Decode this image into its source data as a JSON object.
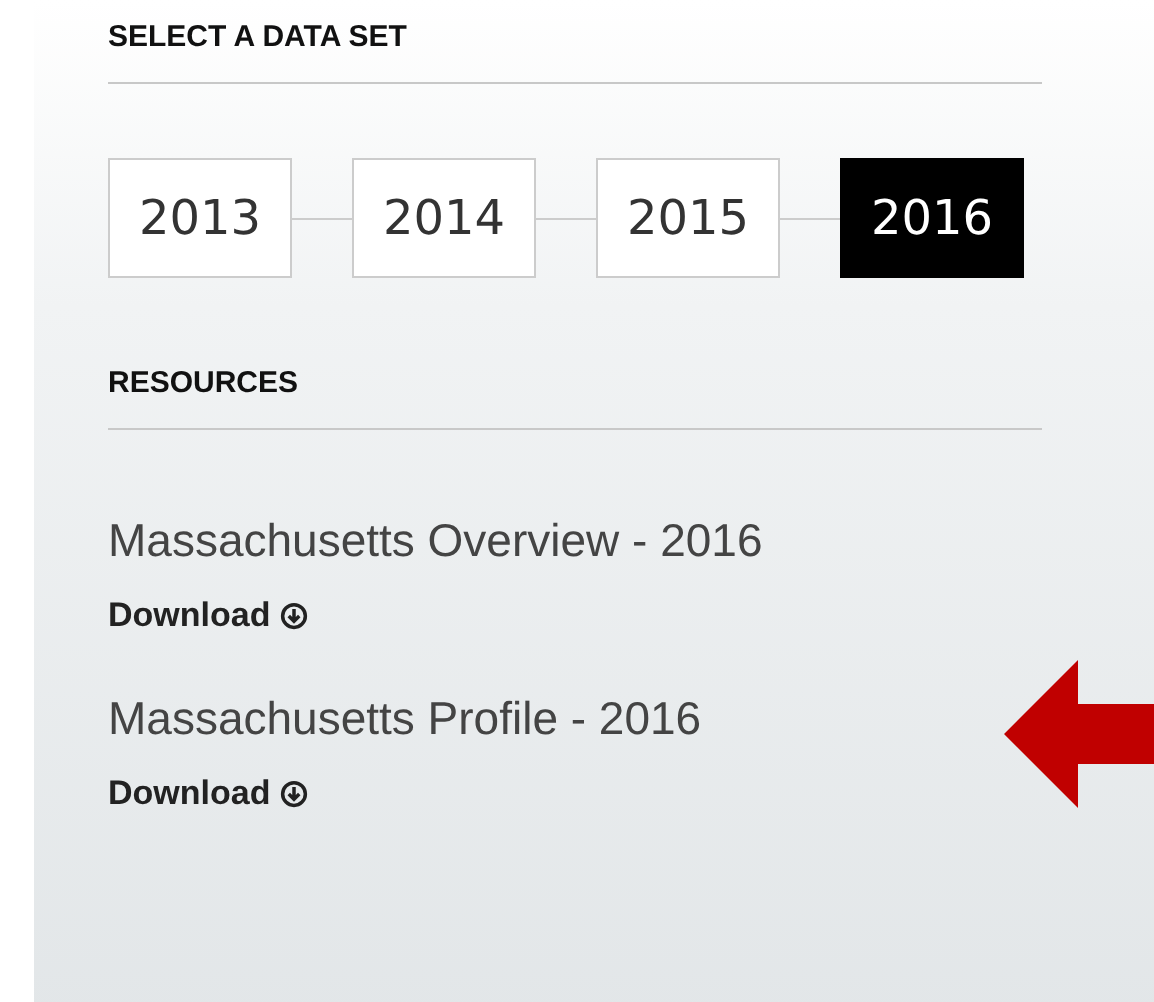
{
  "data_set": {
    "heading": "SELECT A DATA SET",
    "years": [
      {
        "label": "2013",
        "selected": false
      },
      {
        "label": "2014",
        "selected": false
      },
      {
        "label": "2015",
        "selected": false
      },
      {
        "label": "2016",
        "selected": true
      }
    ]
  },
  "resources": {
    "heading": "RESOURCES",
    "items": [
      {
        "title": "Massachusetts Overview - 2016",
        "link": "Download",
        "highlighted": false
      },
      {
        "title": "Massachusetts Profile - 2016",
        "link": "Download",
        "highlighted": true
      }
    ]
  }
}
